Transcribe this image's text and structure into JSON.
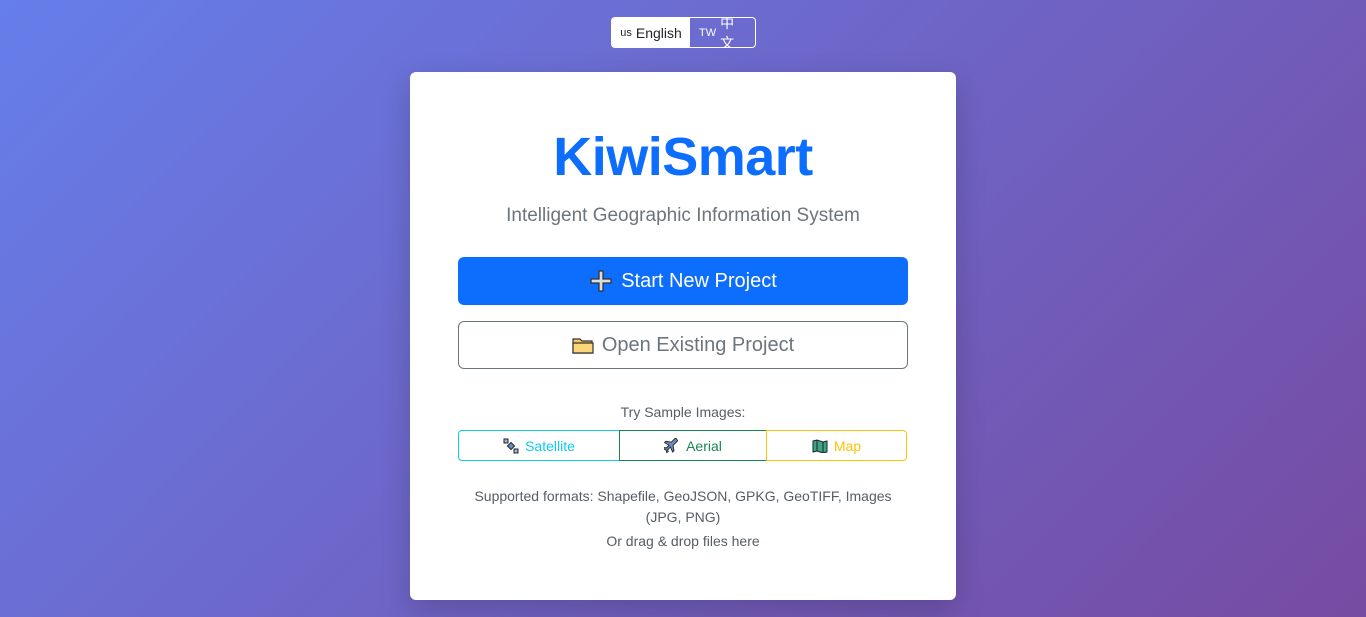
{
  "language": {
    "english": {
      "flag": "us",
      "label": "English"
    },
    "chinese": {
      "flag": "TW",
      "label": "中文"
    }
  },
  "app": {
    "title": "KiwiSmart",
    "subtitle": "Intelligent Geographic Information System"
  },
  "actions": {
    "start_new": "Start New Project",
    "open_existing": "Open Existing Project"
  },
  "samples": {
    "label": "Try Sample Images:",
    "satellite": "Satellite",
    "aerial": "Aerial",
    "map": "Map"
  },
  "info": {
    "formats": "Supported formats: Shapefile, GeoJSON, GPKG, GeoTIFF, Images (JPG, PNG)",
    "dragdrop": "Or drag & drop files here"
  },
  "colors": {
    "primary": "#0d6efd",
    "info": "#0dcaf0",
    "success": "#198754",
    "warning": "#ffc107",
    "background_start": "#667eea",
    "background_end": "#764ba2"
  }
}
